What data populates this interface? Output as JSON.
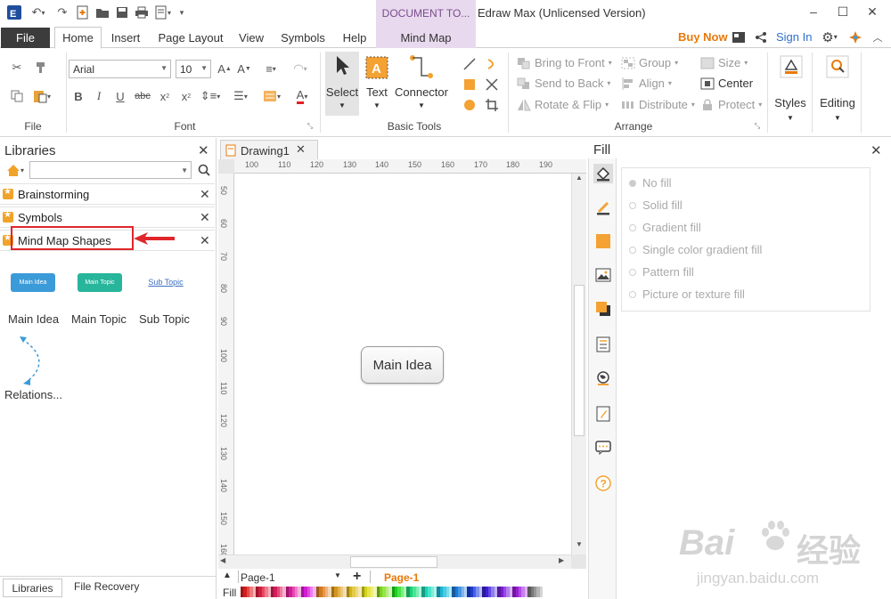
{
  "app": {
    "title": "Edraw Max (Unlicensed Version)",
    "context_tab": "DOCUMENT TO...",
    "buy_now": "Buy Now",
    "sign_in": "Sign In"
  },
  "menu": {
    "file": "File",
    "tabs": [
      "Home",
      "Insert",
      "Page Layout",
      "View",
      "Symbols",
      "Help"
    ],
    "context": "Mind Map"
  },
  "ribbon": {
    "file_group": "File",
    "font_group": "Font",
    "font_name": "Arial",
    "font_size": "10",
    "basic_tools_group": "Basic Tools",
    "select": "Select",
    "text": "Text",
    "connector": "Connector",
    "arrange_group": "Arrange",
    "bring_to_front": "Bring to Front",
    "send_to_back": "Send to Back",
    "rotate_flip": "Rotate & Flip",
    "group": "Group",
    "align": "Align",
    "distribute": "Distribute",
    "size": "Size",
    "center": "Center",
    "protect": "Protect",
    "styles": "Styles",
    "editing": "Editing"
  },
  "libraries": {
    "title": "Libraries",
    "items": [
      "Brainstorming",
      "Symbols",
      "Mind Map Shapes"
    ],
    "shapes": [
      {
        "label": "Main Idea",
        "thumb": "Main Idea"
      },
      {
        "label": "Main Topic",
        "thumb": "Main Topic"
      },
      {
        "label": "Sub Topic",
        "thumb": "Sub Topic"
      },
      {
        "label": "Relations..."
      }
    ],
    "bottom_tabs": [
      "Libraries",
      "File Recovery"
    ]
  },
  "document": {
    "tab": "Drawing1",
    "ruler_h": [
      "100",
      "110",
      "120",
      "130",
      "140",
      "150",
      "160",
      "170",
      "180",
      "190"
    ],
    "ruler_v": [
      "50",
      "60",
      "70",
      "80",
      "90",
      "100",
      "110",
      "120",
      "130",
      "140",
      "150",
      "160"
    ],
    "shape_text": "Main Idea",
    "page_selector": "Page-1",
    "page_tab": "Page-1",
    "fill_label": "Fill"
  },
  "fill_panel": {
    "title": "Fill",
    "options": [
      "No fill",
      "Solid fill",
      "Gradient fill",
      "Single color gradient fill",
      "Pattern fill",
      "Picture or texture fill"
    ],
    "selected_index": 0
  },
  "watermark": {
    "brand": "Bai",
    "brand_cn": "经验",
    "url": "jingyan.baidu.com"
  },
  "colors": {
    "accent_orange": "#e8790b",
    "context_purple": "#e8d9ee",
    "highlight_red": "#e0262a",
    "main_idea_blue": "#3b9bd9",
    "main_topic_teal": "#27b59b"
  }
}
